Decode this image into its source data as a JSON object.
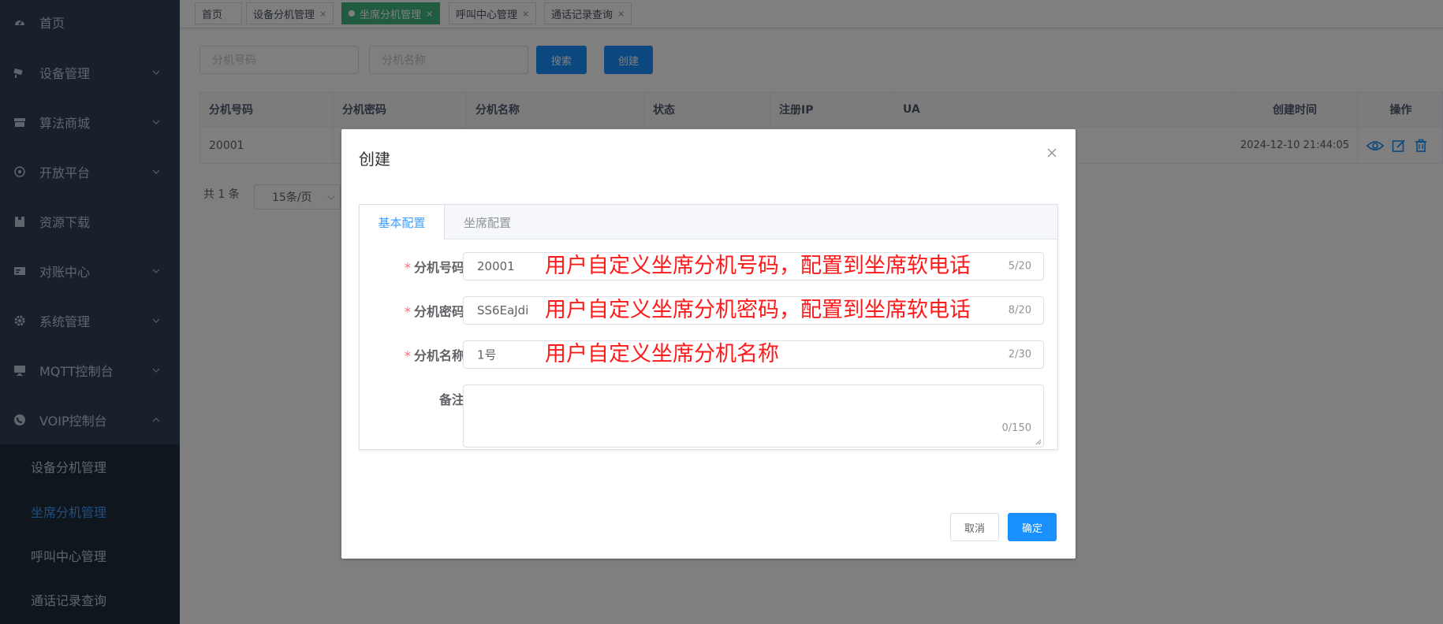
{
  "sidebar": {
    "items": [
      {
        "label": "首页",
        "icon": "dashboard-icon",
        "expandable": false
      },
      {
        "label": "设备管理",
        "icon": "camera-icon",
        "expandable": true
      },
      {
        "label": "算法商城",
        "icon": "shop-icon",
        "expandable": true
      },
      {
        "label": "开放平台",
        "icon": "platform-icon",
        "expandable": true
      },
      {
        "label": "资源下载",
        "icon": "download-icon",
        "expandable": false
      },
      {
        "label": "对账中心",
        "icon": "ledger-icon",
        "expandable": true
      },
      {
        "label": "系统管理",
        "icon": "gear-icon",
        "expandable": true
      },
      {
        "label": "MQTT控制台",
        "icon": "monitor-icon",
        "expandable": true
      },
      {
        "label": "VOIP控制台",
        "icon": "phone-icon",
        "expandable": true
      }
    ],
    "submenu": [
      {
        "label": "设备分机管理",
        "active": false
      },
      {
        "label": "坐席分机管理",
        "active": true
      },
      {
        "label": "呼叫中心管理",
        "active": false
      },
      {
        "label": "通话记录查询",
        "active": false
      }
    ]
  },
  "tags": [
    {
      "label": "首页",
      "closable": false,
      "active": false
    },
    {
      "label": "设备分机管理",
      "closable": true,
      "active": false
    },
    {
      "label": "坐席分机管理",
      "closable": true,
      "active": true
    },
    {
      "label": "呼叫中心管理",
      "closable": true,
      "active": false
    },
    {
      "label": "通话记录查询",
      "closable": true,
      "active": false
    }
  ],
  "search": {
    "ext_number_placeholder": "分机号码",
    "ext_name_placeholder": "分机名称",
    "search_label": "搜索",
    "create_label": "创建"
  },
  "table": {
    "columns": [
      "分机号码",
      "分机密码",
      "分机名称",
      "状态",
      "注册IP",
      "UA",
      "创建时间",
      "操作"
    ],
    "rows": [
      {
        "ext_number": "20001",
        "created_at": "2024-12-10 21:44:05"
      }
    ]
  },
  "pager": {
    "total": "共 1 条",
    "page_size": "15条/页"
  },
  "dialog": {
    "title": "创建",
    "tabs": [
      "基本配置",
      "坐席配置"
    ],
    "fields": {
      "ext_number": {
        "label": "分机号码",
        "value": "20001",
        "count": "5/20",
        "annotation": "用户自定义坐席分机号码，配置到坐席软电话"
      },
      "ext_password": {
        "label": "分机密码",
        "value": "SS6EaJdi",
        "count": "8/20",
        "annotation": "用户自定义坐席分机密码，配置到坐席软电话"
      },
      "ext_name": {
        "label": "分机名称",
        "value": "1号",
        "count": "2/30",
        "annotation": "用户自定义坐席分机名称"
      },
      "remark": {
        "label": "备注",
        "value": "",
        "count": "0/150"
      }
    },
    "cancel_label": "取消",
    "confirm_label": "确定"
  },
  "colors": {
    "sidebar_bg": "#304156",
    "submenu_bg": "#1f2d3d",
    "primary": "#1890ff",
    "active_tag": "#42b983",
    "annotation": "#ff1a1a"
  }
}
